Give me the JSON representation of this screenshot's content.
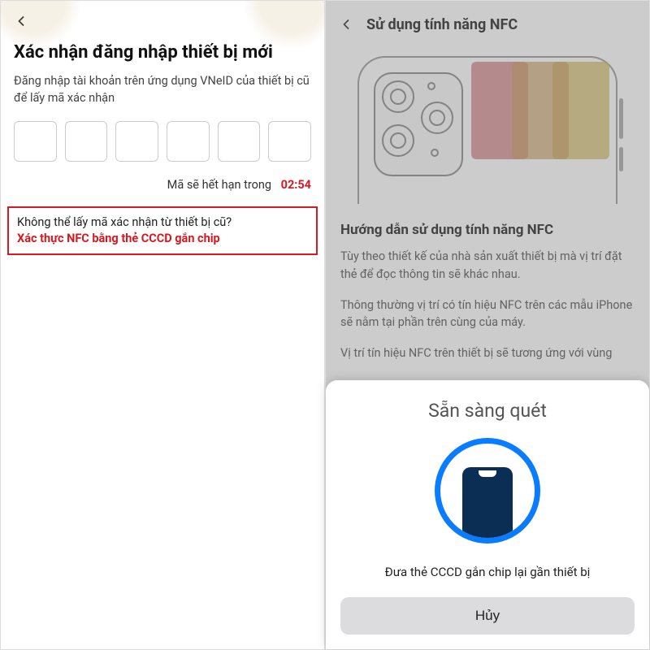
{
  "left": {
    "title": "Xác nhận đăng nhập thiết bị mới",
    "description": "Đăng nhập tài khoản trên ứng dụng VNeID của thiết bị cũ để lấy mã xác nhận",
    "expiry_label": "Mã sẽ hết hạn trong",
    "expiry_time": "02:54",
    "nfc_question": "Không thể lấy mã xác nhận từ thiết bị cũ?",
    "nfc_link": "Xác thực NFC bằng thẻ CCCD gắn chip",
    "otp_count": 6
  },
  "right": {
    "title": "Sử dụng tính năng NFC",
    "guide_title": "Hướng dẫn sử dụng tính năng NFC",
    "guide_p1": "Tùy theo thiết kế của nhà sản xuất thiết bị mà vị trí đặt thẻ để đọc thông tin sẽ khác nhau.",
    "guide_p2": "Thông thường vị trí có tín hiệu NFC trên các mẫu iPhone sẽ nằm tại phần trên cùng của máy.",
    "guide_p3": "Vị trí tín hiệu NFC trên thiết bị sẽ tương ứng với vùng"
  },
  "sheet": {
    "title": "Sẵn sàng quét",
    "message": "Đưa thẻ CCCD gắn chip lại gần thiết bị",
    "cancel": "Hủy"
  }
}
